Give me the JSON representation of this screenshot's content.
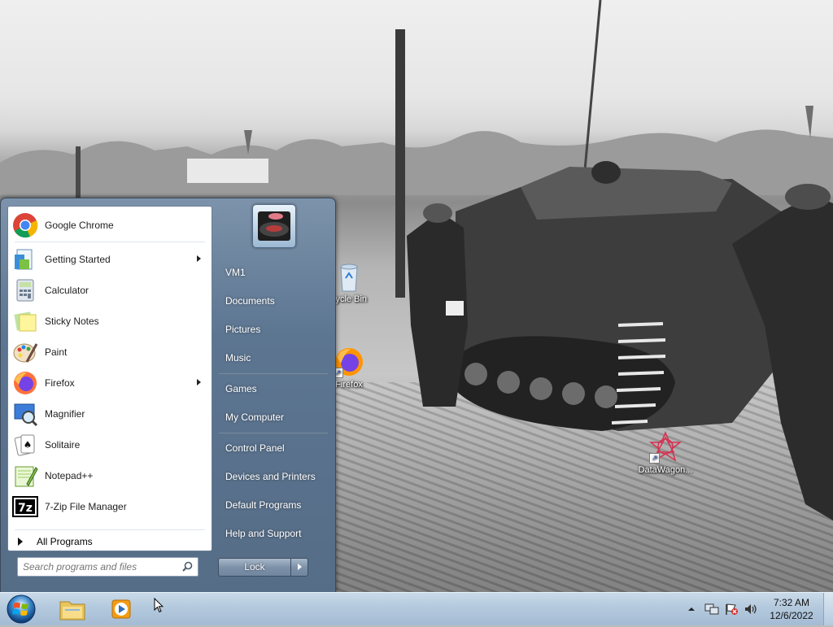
{
  "desktop": {
    "icons": [
      {
        "label": "cycle Bin",
        "icon": "recycle-bin-icon"
      },
      {
        "label": "Firefox",
        "icon": "firefox-icon"
      },
      {
        "label": "DataWagon...",
        "icon": "datawagon-icon"
      }
    ]
  },
  "start_menu": {
    "pinned_programs": [
      {
        "label": "Google Chrome",
        "icon": "chrome-icon",
        "submenu": false
      },
      {
        "label": "Getting Started",
        "icon": "getting-started-icon",
        "submenu": true
      },
      {
        "label": "Calculator",
        "icon": "calculator-icon",
        "submenu": false
      },
      {
        "label": "Sticky Notes",
        "icon": "sticky-notes-icon",
        "submenu": false
      },
      {
        "label": "Paint",
        "icon": "paint-icon",
        "submenu": false
      },
      {
        "label": "Firefox",
        "icon": "firefox-icon",
        "submenu": true
      },
      {
        "label": "Magnifier",
        "icon": "magnifier-icon",
        "submenu": false
      },
      {
        "label": "Solitaire",
        "icon": "solitaire-icon",
        "submenu": false
      },
      {
        "label": "Notepad++",
        "icon": "notepad-plus-plus-icon",
        "submenu": false
      },
      {
        "label": "7-Zip File Manager",
        "icon": "seven-zip-icon",
        "submenu": false
      }
    ],
    "all_programs_label": "All Programs",
    "search": {
      "placeholder": "Search programs and files"
    },
    "right_items": [
      {
        "label": "VM1"
      },
      {
        "label": "Documents"
      },
      {
        "label": "Pictures"
      },
      {
        "label": "Music"
      },
      {
        "label": "Games"
      },
      {
        "label": "My Computer"
      },
      {
        "label": "Control Panel"
      },
      {
        "label": "Devices and Printers"
      },
      {
        "label": "Default Programs"
      },
      {
        "label": "Help and Support"
      }
    ],
    "lock_label": "Lock"
  },
  "taskbar": {
    "pinned": [
      {
        "name": "file-explorer",
        "icon": "folder-icon"
      },
      {
        "name": "media-player",
        "icon": "media-player-icon"
      }
    ],
    "clock": {
      "time": "7:32 AM",
      "date": "12/6/2022"
    },
    "tray_icons": [
      "show-hidden-icons-icon",
      "network-icon",
      "action-center-icon",
      "volume-icon"
    ]
  },
  "colors": {
    "start_menu_blue": "#5c7591",
    "taskbar": "#b4c9dd"
  }
}
